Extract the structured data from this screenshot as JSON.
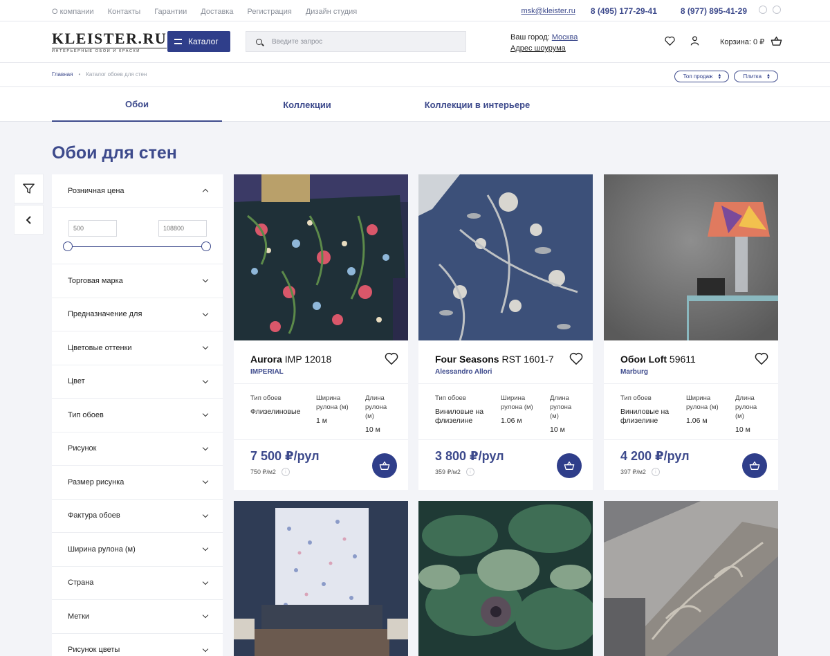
{
  "topnav": [
    "О компании",
    "Контакты",
    "Гарантии",
    "Доставка",
    "Регистрация",
    "Дизайн студия"
  ],
  "contacts": {
    "email": "msk@kleister.ru",
    "phone1": "8 (495) 177-29-41",
    "phone2": "8 (977) 895-41-29"
  },
  "logo": {
    "main": "KLEISTER.RU",
    "sub": "Интерьерные обои и краски"
  },
  "header": {
    "catalog_label": "Каталог",
    "search_placeholder": "Введите запрос",
    "city_prefix": "Ваш город:",
    "city": "Москва",
    "showroom": "Адрес шоурума",
    "cart": "Корзина: 0 ₽"
  },
  "breadcrumb": {
    "home": "Главная",
    "sep": "•",
    "current": "Каталог обоев для стен"
  },
  "sort": {
    "order": "Топ продаж",
    "view": "Плитка"
  },
  "tabs": [
    "Обои",
    "Коллекции",
    "Коллекции в интерьере"
  ],
  "page_title": "Обои для стен",
  "filters": {
    "price_label": "Розничная цена",
    "price_min": "500",
    "price_max": "108800",
    "items": [
      "Торговая марка",
      "Предназначение для",
      "Цветовые оттенки",
      "Цвет",
      "Тип обоев",
      "Рисунок",
      "Размер рисунка",
      "Фактура обоев",
      "Ширина рулона (м)",
      "Страна",
      "Метки",
      "Рисунок цветы"
    ]
  },
  "spec_labels": {
    "type": "Тип обоев",
    "width": "Ширина рулона (м)",
    "length": "Длина рулона (м)"
  },
  "products": [
    {
      "name": "Aurora",
      "code": "IMP 12018",
      "brand": "IMPERIAL",
      "type": "Флизелиновые",
      "width": "1 м",
      "length": "10 м",
      "price": "7 500 ₽/рул",
      "ppm": "750 ₽/м2"
    },
    {
      "name": "Four Seasons",
      "code": "RST 1601-7",
      "brand": "Alessandro Allori",
      "type": "Виниловые на флизелине",
      "width": "1.06 м",
      "length": "10 м",
      "price": "3 800 ₽/рул",
      "ppm": "359 ₽/м2"
    },
    {
      "name": "Обои Loft",
      "code": "59611",
      "brand": "Marburg",
      "type": "Виниловые на флизелине",
      "width": "1.06 м",
      "length": "10 м",
      "price": "4 200 ₽/рул",
      "ppm": "397 ₽/м2"
    }
  ],
  "colors": {
    "accent": "#3d4a8c",
    "button": "#2f3e8a",
    "bg": "#f3f4f8"
  }
}
